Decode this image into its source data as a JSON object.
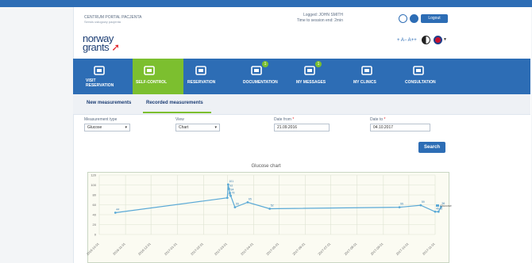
{
  "header": {
    "portal_name": "CENTRUM PORTAL PACJENTA",
    "portal_sub": "Serwis usługowy pacjenta",
    "login_line1": "Logged: JOHN SMITH",
    "login_line2": "Time to session end: 2min",
    "logout_label": "Logout",
    "a11y_text": "+ A− A++"
  },
  "logo": {
    "text": "norway grants",
    "line1": "norway",
    "line2": "grants"
  },
  "nav": {
    "items": [
      {
        "label": "VISIT RESERVATION",
        "icon": "calendar-check-icon",
        "active": false
      },
      {
        "label": "SELF-CONTROL",
        "icon": "heart-pulse-icon",
        "active": true
      },
      {
        "label": "RESERVATION",
        "icon": "clipboard-icon",
        "active": false
      },
      {
        "label": "DOCUMENTATION",
        "icon": "folder-icon",
        "active": false,
        "badge": "1"
      },
      {
        "label": "MY MESSAGES",
        "icon": "envelope-icon",
        "active": false,
        "badge": "1"
      },
      {
        "label": "MY CLINICS",
        "icon": "building-icon",
        "active": false
      },
      {
        "label": "CONSULTATION",
        "icon": "chat-icon",
        "active": false
      }
    ]
  },
  "tabs": {
    "new": "New measurements",
    "recorded": "Recorded measurements"
  },
  "form": {
    "measurement_label": "Measurement type",
    "measurement_value": "Glucose",
    "view_label": "View",
    "view_value": "Chart",
    "date_from_label": "Date from",
    "date_from_value": "21.09.2016",
    "date_to_label": "Date to",
    "date_to_value": "04.10.2017",
    "search_label": "Search"
  },
  "chart_data": {
    "type": "line",
    "title": "Glucose chart",
    "ylim": [
      0,
      120
    ],
    "yticks": [
      0,
      20,
      40,
      60,
      80,
      100,
      120
    ],
    "xticks": [
      "2016-10-01",
      "2016-11-01",
      "2016-12-01",
      "2017-01-01",
      "2017-02-01",
      "2017-03-01",
      "2017-04-01",
      "2017-05-01",
      "2017-06-01",
      "2017-07-01",
      "2017-08-01",
      "2017-09-01",
      "2017-10-01",
      "2017-11-01"
    ],
    "x": [
      "2016-10-20",
      "2017-03-01",
      "2017-03-02",
      "2017-03-03",
      "2017-03-04",
      "2017-03-05",
      "2017-03-10",
      "2017-03-25",
      "2017-04-20",
      "2017-09-20",
      "2017-10-15",
      "2017-11-01",
      "2017-11-05",
      "2017-11-08"
    ],
    "series": [
      {
        "name": "Glucose",
        "values": [
          44,
          74,
          101,
          92,
          84,
          78,
          55,
          65,
          52,
          55,
          59,
          46,
          46,
          56
        ]
      }
    ],
    "legend": "right",
    "grid": true,
    "colors": {
      "line": "#5aa9d6",
      "grid": "#dde3d2"
    }
  },
  "colors": {
    "brand": "#2d6db5",
    "active": "#7cbf2f"
  }
}
